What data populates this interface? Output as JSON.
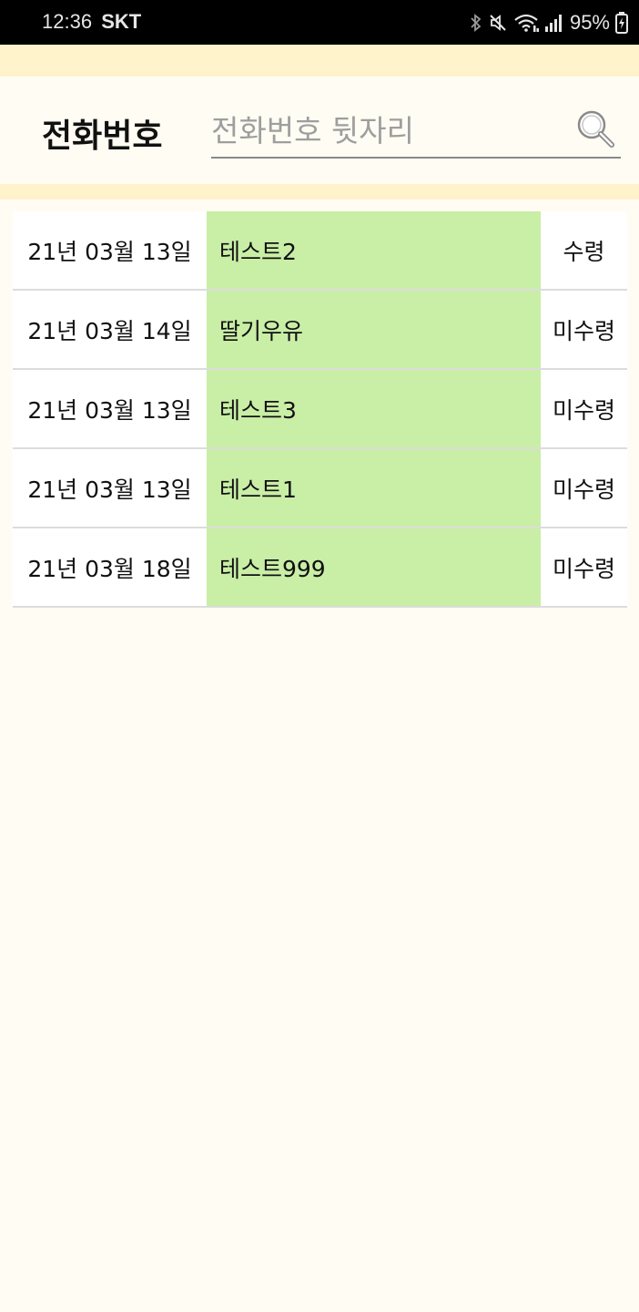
{
  "status_bar": {
    "time": "12:36",
    "carrier": "SKT",
    "battery": "95%",
    "icons": [
      "bluetooth-icon",
      "mute-icon",
      "wifi-icon",
      "signal-icon",
      "battery-charging-icon"
    ]
  },
  "search": {
    "label": "전화번호",
    "placeholder": "전화번호 뒷자리",
    "value": "",
    "icon": "search-icon"
  },
  "colors": {
    "band": "#fff3cc",
    "background": "#fffcf3",
    "name_cell": "#c9eea6"
  },
  "list": {
    "rows": [
      {
        "date": "21년 03월 13일",
        "name": "테스트2",
        "status": "수령"
      },
      {
        "date": "21년 03월 14일",
        "name": "딸기우유",
        "status": "미수령"
      },
      {
        "date": "21년 03월 13일",
        "name": "테스트3",
        "status": "미수령"
      },
      {
        "date": "21년 03월 13일",
        "name": "테스트1",
        "status": "미수령"
      },
      {
        "date": "21년 03월 18일",
        "name": "테스트999",
        "status": "미수령"
      }
    ]
  }
}
